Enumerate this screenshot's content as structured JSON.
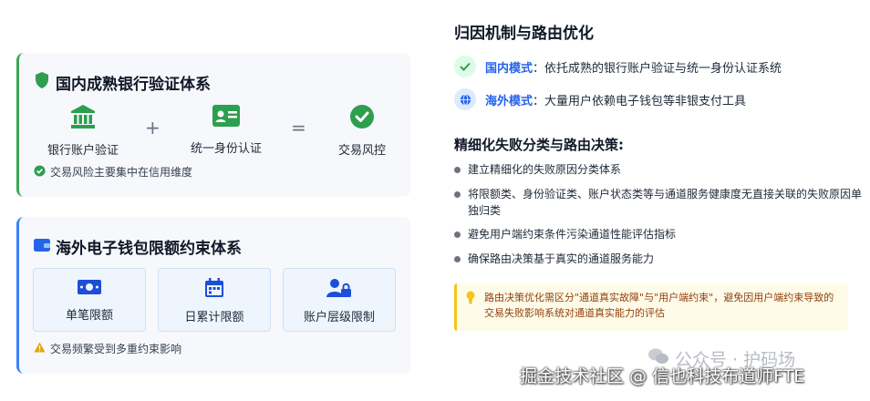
{
  "domestic": {
    "title": "国内成熟银行验证体系",
    "items": [
      {
        "label": "银行账户验证",
        "icon": "bank-icon"
      },
      {
        "label": "统一身份认证",
        "icon": "id-card-icon"
      },
      {
        "label": "交易风控",
        "icon": "check-circle-icon"
      }
    ],
    "plus": "+",
    "equals": "=",
    "note": "交易风险主要集中在信用维度"
  },
  "overseas": {
    "title": "海外电子钱包限额约束体系",
    "limits": [
      {
        "label": "单笔限额",
        "icon": "money-bill-icon"
      },
      {
        "label": "日累计限额",
        "icon": "calendar-icon"
      },
      {
        "label": "账户层级限制",
        "icon": "user-lock-icon"
      }
    ],
    "note": "交易频繁受到多重约束影响"
  },
  "routing": {
    "title": "归因机制与路由优化",
    "modes": [
      {
        "key": "国内模式",
        "text": "：依托成熟的银行账户验证与统一身份认证系统"
      },
      {
        "key": "海外模式",
        "text": "：大量用户依赖电子钱包等非银支付工具"
      }
    ],
    "subtitle": "精细化失败分类与路由决策:",
    "bullets": [
      "建立精细化的失败原因分类体系",
      "将限额类、身份验证类、账户状态类等与通道服务健康度无直接关联的失败原因单独归类",
      "避免用户端约束条件污染通道性能评估指标",
      "确保路由决策基于真实的通道服务能力"
    ],
    "tip": "路由决策优化需区分\"通道真实故障\"与\"用户端约束\"，避免因用户端约束导致的交易失败影响系统对通道真实能力的评估"
  },
  "watermarks": {
    "wechat": "公众号 · 护码场",
    "juejin": "掘金技术社区 @ 信也科技布道师FTE"
  },
  "colors": {
    "green": "#3aa757",
    "blue": "#3b82f6",
    "tip_border": "#f5c518"
  }
}
